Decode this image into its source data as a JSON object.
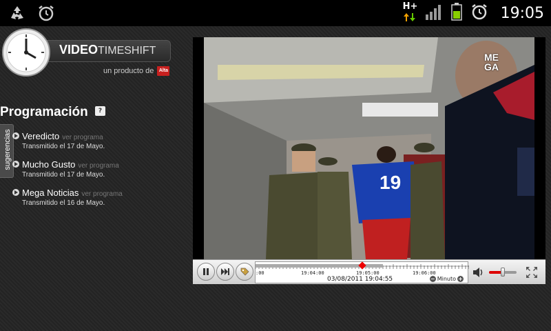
{
  "status_bar": {
    "time": "19:05",
    "network_type": "H+",
    "icons": [
      "recycle-icon",
      "alarm-clock-icon",
      "network-arrows-icon",
      "signal-icon",
      "battery-icon",
      "alarm-icon"
    ]
  },
  "app": {
    "logo_title_bold": "VIDEO",
    "logo_title_light": "TIMESHIFT",
    "logo_subtitle": "un producto de",
    "logo_brand": "Alta",
    "section_title": "Programación",
    "help_glyph": "?",
    "suggestions_tab": "sugerencias",
    "programs": [
      {
        "name": "Veredicto",
        "link": "ver programa",
        "date": "Transmitido el 17 de Mayo."
      },
      {
        "name": "Mucho Gusto",
        "link": "ver programa",
        "date": "Transmitido el 17 de Mayo."
      },
      {
        "name": "Mega Noticias",
        "link": "ver programa",
        "date": "Transmitido el 16 de Mayo."
      }
    ]
  },
  "video": {
    "channel_logo": [
      "ME",
      "GA"
    ],
    "player_jersey_number": "19"
  },
  "controls": {
    "tick_labels": [
      ":00",
      "19:04:00",
      "19:05:00",
      "19:06:00"
    ],
    "datetime": "03/08/2011 19:04:55",
    "zoom_label": "Minuto",
    "minus": "−",
    "plus": "+",
    "progress_fraction": 0.5,
    "volume_fraction": 0.5
  },
  "colors": {
    "accent_red": "#e00000",
    "statusbar_bg": "#000000"
  }
}
